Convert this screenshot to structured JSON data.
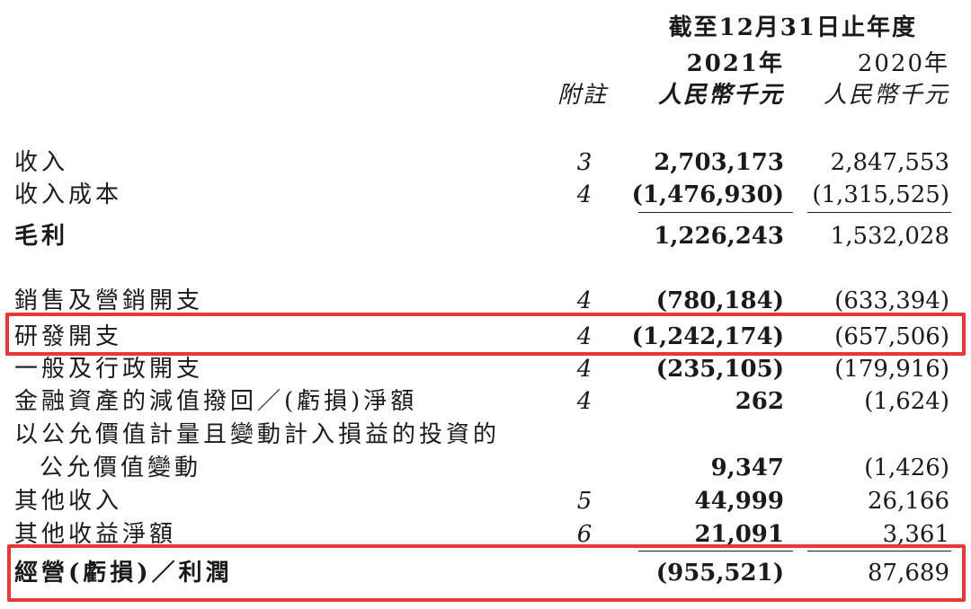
{
  "header": {
    "period": "截至12月31日止年度",
    "year_2021": "2021年",
    "year_2020": "2020年",
    "note_label": "附註",
    "currency_2021": "人民幣千元",
    "currency_2020": "人民幣千元"
  },
  "rows": [
    {
      "label": "收入",
      "note": "3",
      "y2021": "2,703,173",
      "y2020": "2,847,553"
    },
    {
      "label": "收入成本",
      "note": "4",
      "y2021": "(1,476,930)",
      "y2020": "(1,315,525)"
    },
    {
      "label": "毛利",
      "note": "",
      "y2021": "1,226,243",
      "y2020": "1,532,028"
    },
    {
      "label": "銷售及營銷開支",
      "note": "4",
      "y2021": "(780,184)",
      "y2020": "(633,394)"
    },
    {
      "label": "研發開支",
      "note": "4",
      "y2021": "(1,242,174)",
      "y2020": "(657,506)"
    },
    {
      "label": "一般及行政開支",
      "note": "4",
      "y2021": "(235,105)",
      "y2020": "(179,916)"
    },
    {
      "label": "金融資產的減值撥回／(虧損)淨額",
      "note": "4",
      "y2021": "262",
      "y2020": "(1,624)"
    },
    {
      "label": "以公允價值計量且變動計入損益的投資的",
      "note": "",
      "y2021": "",
      "y2020": ""
    },
    {
      "label": "公允價值變動",
      "note": "",
      "y2021": "9,347",
      "y2020": "(1,426)"
    },
    {
      "label": "其他收入",
      "note": "5",
      "y2021": "44,999",
      "y2020": "26,166"
    },
    {
      "label": "其他收益淨額",
      "note": "6",
      "y2021": "21,091",
      "y2020": "3,361"
    },
    {
      "label": "經營(虧損)／利潤",
      "note": "",
      "y2021": "(955,521)",
      "y2020": "87,689"
    }
  ],
  "highlight_color": "#e53935"
}
